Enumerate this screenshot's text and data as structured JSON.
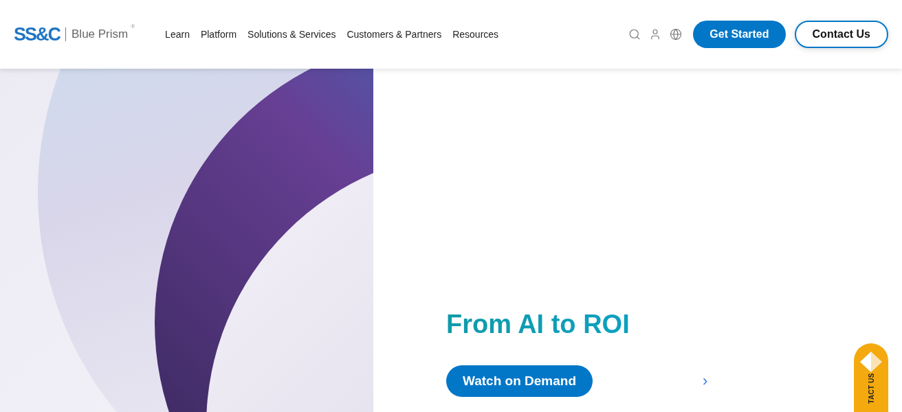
{
  "logo": {
    "mark": "SS&C",
    "product": "Blue Prism",
    "registered": "®"
  },
  "nav": [
    {
      "label": "Learn"
    },
    {
      "label": "Platform"
    },
    {
      "label": "Solutions & Services"
    },
    {
      "label": "Customers & Partners"
    },
    {
      "label": "Resources"
    }
  ],
  "header_buttons": {
    "primary": "Get Started",
    "secondary": "Contact Us"
  },
  "hero": {
    "heading": "From AI to ROI",
    "cta": "Watch on Demand",
    "next": "›"
  },
  "side_tab": {
    "label": "TACT US"
  }
}
